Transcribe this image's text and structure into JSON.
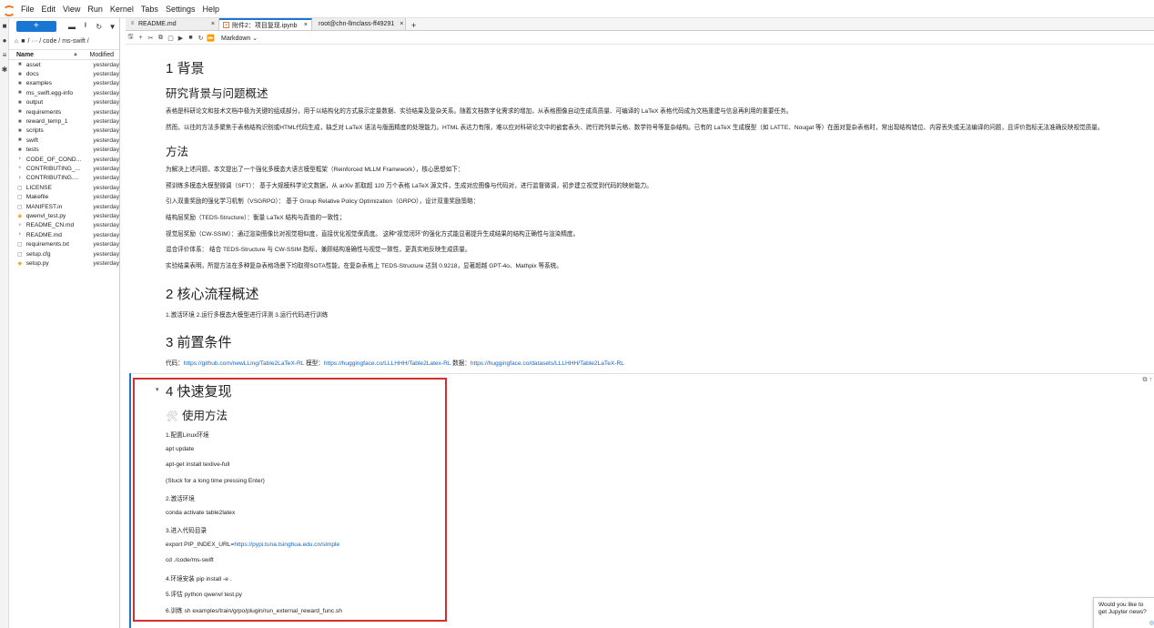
{
  "menubar": {
    "items": [
      "File",
      "Edit",
      "View",
      "Run",
      "Kernel",
      "Tabs",
      "Settings",
      "Help"
    ]
  },
  "filebrowser": {
    "new_label": "+",
    "breadcrumb": "/ ··· / code / ms-swift /",
    "col_name": "Name",
    "col_modified": "Modified",
    "files": [
      {
        "name": "asset",
        "modified": "yesterday",
        "icon": "folder-icon"
      },
      {
        "name": "docs",
        "modified": "yesterday",
        "icon": "folder-icon"
      },
      {
        "name": "examples",
        "modified": "yesterday",
        "icon": "folder-icon"
      },
      {
        "name": "ms_swift.egg-info",
        "modified": "yesterday",
        "icon": "folder-icon"
      },
      {
        "name": "output",
        "modified": "yesterday",
        "icon": "folder-icon"
      },
      {
        "name": "requirements",
        "modified": "yesterday",
        "icon": "folder-icon"
      },
      {
        "name": "reward_temp_1",
        "modified": "yesterday",
        "icon": "folder-icon"
      },
      {
        "name": "scripts",
        "modified": "yesterday",
        "icon": "folder-icon"
      },
      {
        "name": "swift",
        "modified": "yesterday",
        "icon": "folder-icon"
      },
      {
        "name": "tests",
        "modified": "yesterday",
        "icon": "folder-icon"
      },
      {
        "name": "CODE_OF_COND...",
        "modified": "yesterday",
        "icon": "markdown-icon"
      },
      {
        "name": "CONTRIBUTING_...",
        "modified": "yesterday",
        "icon": "markdown-icon"
      },
      {
        "name": "CONTRIBUTING....",
        "modified": "yesterday",
        "icon": "markdown-icon"
      },
      {
        "name": "LICENSE",
        "modified": "yesterday",
        "icon": "file-icon"
      },
      {
        "name": "Makefile",
        "modified": "yesterday",
        "icon": "file-icon"
      },
      {
        "name": "MANIFEST.in",
        "modified": "yesterday",
        "icon": "file-icon"
      },
      {
        "name": "qwenvl_test.py",
        "modified": "yesterday",
        "icon": "python-icon"
      },
      {
        "name": "README_CN.md",
        "modified": "yesterday",
        "icon": "markdown-icon"
      },
      {
        "name": "README.md",
        "modified": "yesterday",
        "icon": "markdown-icon"
      },
      {
        "name": "requirements.txt",
        "modified": "yesterday",
        "icon": "file-icon"
      },
      {
        "name": "setup.cfg",
        "modified": "yesterday",
        "icon": "file-icon"
      },
      {
        "name": "setup.py",
        "modified": "yesterday",
        "icon": "python-icon"
      }
    ]
  },
  "tabs": [
    {
      "label": "README.md",
      "active": false
    },
    {
      "label": "附件2：项目复现.ipynb",
      "active": true
    },
    {
      "label": "root@chn-llmclass-ff49291",
      "active": false
    }
  ],
  "nbtoolbar": {
    "cell_type": "Markdown"
  },
  "notebook": {
    "s1_title": "1 背景",
    "s1_sub": "研究背景与问题概述",
    "s1_p1": "表格是科研论文和技术文档中极为关键的组成部分，用于以结构化的方式展示定量数据、实验结果及复杂关系。随着文档数字化需求的增加，从表格图像自动生成高质量、可编译的 LaTeX 表格代码成为文档重建与信息再利用的重要任务。",
    "s1_p2": "然而，以往的方法多聚焦于表格结构识别或HTML代码生成，缺乏对 LaTeX 语法与版面精度的处理能力。HTML 表达力有限，难以应对科研论文中的嵌套表头、跨行跨列单元格、数学符号等复杂结构。已有的 LaTeX 生成模型（如 LATTE、Nougat 等）在面对复杂表格时，常出现结构错位、内容丢失或无法编译的问题，且评价指标无法准确反映视觉质量。",
    "s1_method": "方法",
    "m_p1": "为解决上述问题，本文提出了一个强化多模态大语言模型框架（Reinforced MLLM Framework），核心思想如下：",
    "m_p2": "预训练多模态大模型微调（SFT）： 基于大规模科学论文数据，从 arXiv 抓取超 120 万个表格 LaTeX 源文件，生成对应图像与代码对，进行监督微调，初步建立视觉到代码的映射能力。",
    "m_p3": "引入双重奖励的强化学习机制（VSGRPO）： 基于 Group Relative Policy Optimization（GRPO），设计双重奖励策略：",
    "m_p4": "结构层奖励（TEDS-Structure）：衡量 LaTeX 结构与真值的一致性；",
    "m_p5": "视觉层奖励（CW-SSIM）：通过渲染图像比对视觉相似度，直接优化视觉保真度。 这种“视觉闭环”的强化方式能显著提升生成结果的结构正确性与渲染精度。",
    "m_p6": "混合评价体系： 结合 TEDS-Structure 与 CW-SSIM 指标，兼顾结构准确性与视觉一致性，更真实地反映生成质量。",
    "m_p7": "实验结果表明，所提方法在多种复杂表格场景下均取得SOTA性能，在复杂表格上 TEDS-Structure 达到 0.9218，显著超越 GPT-4o、Mathpix 等系统。",
    "s2_title": "2 核心流程概述",
    "s2_p": "1.激活环境 2.运行多模态大模型进行评测 3.运行代码进行训练",
    "s3_title": "3 前置条件",
    "s3_code_label": "代码：",
    "s3_code_link": "https://github.com/newLLing/Table2LaTeX-RL",
    "s3_model_label": " 模型：",
    "s3_model_link": "https://huggingface.co/LLLHHH/Table2Latex-RL",
    "s3_data_label": " 数据：",
    "s3_data_link": "https://huggingface.co/datasets/LLLHHH/Table2LaTeX-RL",
    "s4_title": "4 快速复现",
    "s4_sub": "使用方法",
    "s4_lines": [
      "1.配置Linux环境",
      "apt update",
      "apt-get install texlive-full",
      "(Stuck for a long time pressing Enter)",
      "2.激活环境",
      "conda activate table2latex",
      "3.进入代码目录",
      "export PIP_INDEX_URL=",
      "cd ./code/ms-swift",
      "4.环境安装 pip install -e .",
      "5.评估 python qwenvl test.py",
      "6.训练 sh examples/train/grpo/plugin/run_external_reward_func.sh"
    ],
    "s4_pip_link": "https://pypi.tuna.tsinghua.edu.cn/simple"
  },
  "notification": {
    "text": "Would you like to get Jupyter news?"
  },
  "colors": {
    "accent": "#1976d2",
    "highlight_box": "#d32f2f",
    "link": "#1565c0"
  }
}
